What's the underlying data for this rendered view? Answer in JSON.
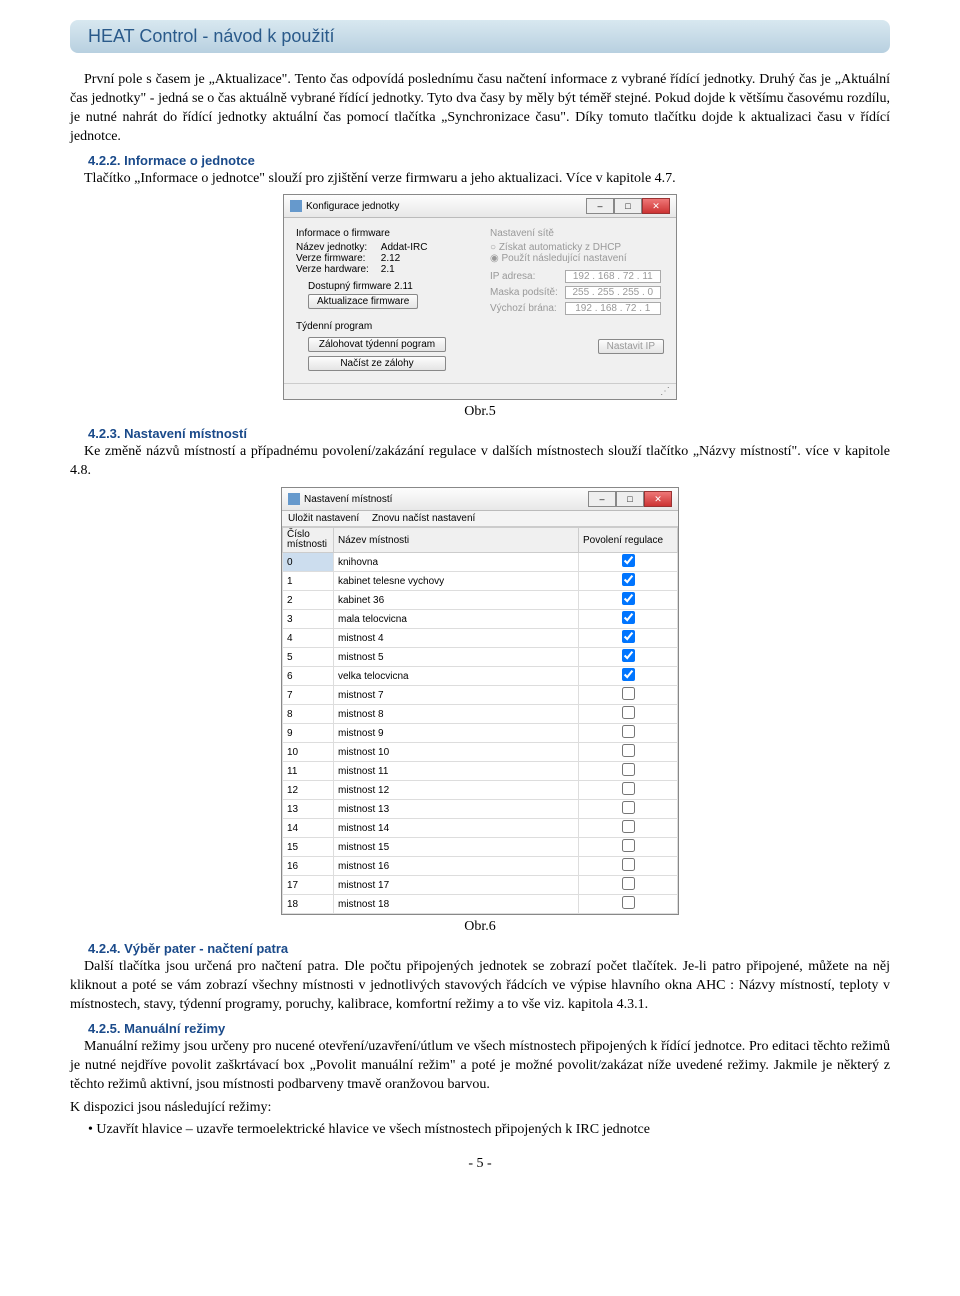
{
  "header": {
    "title": "HEAT Control - návod k použití"
  },
  "p1": "První pole s časem je „Aktualizace\". Tento čas odpovídá poslednímu času načtení informace z vybrané řídící jednotky. Druhý čas je „Aktuální čas jednotky\" - jedná se o čas aktuálně vybrané řídící jednotky. Tyto dva časy by měly být téměř stejné. Pokud dojde k většímu časovému rozdílu, je nutné nahrát do řídící jednotky aktuální čas pomocí tlačítka „Synchronizace času\". Díky tomuto tlačítku dojde k aktualizaci času v řídící jednotce.",
  "s422": {
    "h": "4.2.2. Informace o jednotce",
    "t": "Tlačítko „Informace o jednotce\" slouží pro zjištění verze firmwaru a jeho aktualizaci. Více v kapitole 4.7."
  },
  "dlg1": {
    "title": "Konfigurace jednotky",
    "grp_fw": "Informace o firmware",
    "name_l": "Název jednotky:",
    "name_v": "Addat-IRC",
    "fw_l": "Verze firmware:",
    "fw_v": "2.12",
    "hw_l": "Verze hardware:",
    "hw_v": "2.1",
    "avail": "Dostupný firmware 2.11",
    "btn_upd": "Aktualizace firmware",
    "grp_week": "Týdenní program",
    "btn_backup": "Zálohovat týdenní pogram",
    "btn_load": "Načíst ze zálohy",
    "grp_net": "Nastavení sítě",
    "r1": "Získat automaticky z DHCP",
    "r2": "Použít následující nastavení",
    "ip_l": "IP adresa:",
    "ip_v": "192 . 168 . 72 . 11",
    "mask_l": "Maska podsítě:",
    "mask_v": "255 . 255 . 255 . 0",
    "gw_l": "Výchozí brána:",
    "gw_v": "192 . 168 . 72 . 1",
    "btn_setip": "Nastavit IP"
  },
  "cap5": "Obr.5",
  "s423": {
    "h": "4.2.3. Nastavení místností",
    "t": "Ke změně názvů místností a případnému povolení/zakázání regulace v dalších místnostech slouží tlačítko „Názvy místností\". více v kapitole 4.8."
  },
  "dlg2": {
    "title": "Nastavení místností",
    "menu1": "Uložit nastavení",
    "menu2": "Znovu načíst nastavení",
    "col1": "Číslo místnosti",
    "col2": "Název místnosti",
    "col3": "Povolení regulace",
    "rows": [
      {
        "n": "0",
        "name": "knihovna",
        "c": true
      },
      {
        "n": "1",
        "name": "kabinet telesne vychovy",
        "c": true
      },
      {
        "n": "2",
        "name": "kabinet 36",
        "c": true
      },
      {
        "n": "3",
        "name": "mala telocvicna",
        "c": true
      },
      {
        "n": "4",
        "name": "mistnost 4",
        "c": true
      },
      {
        "n": "5",
        "name": "mistnost 5",
        "c": true
      },
      {
        "n": "6",
        "name": "velka telocvicna",
        "c": true
      },
      {
        "n": "7",
        "name": "mistnost 7",
        "c": false
      },
      {
        "n": "8",
        "name": "mistnost 8",
        "c": false
      },
      {
        "n": "9",
        "name": "mistnost 9",
        "c": false
      },
      {
        "n": "10",
        "name": "mistnost 10",
        "c": false
      },
      {
        "n": "11",
        "name": "mistnost 11",
        "c": false
      },
      {
        "n": "12",
        "name": "mistnost 12",
        "c": false
      },
      {
        "n": "13",
        "name": "mistnost 13",
        "c": false
      },
      {
        "n": "14",
        "name": "mistnost 14",
        "c": false
      },
      {
        "n": "15",
        "name": "mistnost 15",
        "c": false
      },
      {
        "n": "16",
        "name": "mistnost 16",
        "c": false
      },
      {
        "n": "17",
        "name": "mistnost 17",
        "c": false
      },
      {
        "n": "18",
        "name": "mistnost 18",
        "c": false
      }
    ]
  },
  "cap6": "Obr.6",
  "s424": {
    "h": "4.2.4. Výběr pater - načtení patra",
    "t": "Další tlačítka jsou určená pro načtení patra. Dle počtu připojených jednotek se zobrazí počet tlačítek. Je-li patro připojené, můžete na něj kliknout a poté se vám zobrazí všechny místnosti v jednotlivých stavových řádcích ve výpise hlavního okna AHC : Názvy místností, teploty v místnostech, stavy, týdenní programy, poruchy, kalibrace, komfortní režimy a to vše viz. kapitola 4.3.1."
  },
  "s425": {
    "h": "4.2.5. Manuální režimy",
    "t1": "Manuální režimy jsou určeny pro nucené otevření/uzavření/útlum ve všech místnostech připojených k řídící jednotce. Pro editaci těchto režimů je nutné nejdříve povolit zaškrtávací box „Povolit manuální režim\" a poté je možné povolit/zakázat níže uvedené režimy. Jakmile je některý z těchto režimů aktivní, jsou místnosti podbarveny tmavě oranžovou barvou.",
    "t2": "K dispozici jsou následující režimy:",
    "b1": "• Uzavřít hlavice – uzavře termoelektrické hlavice ve všech místnostech připojených k IRC jednotce"
  },
  "page": "- 5 -"
}
